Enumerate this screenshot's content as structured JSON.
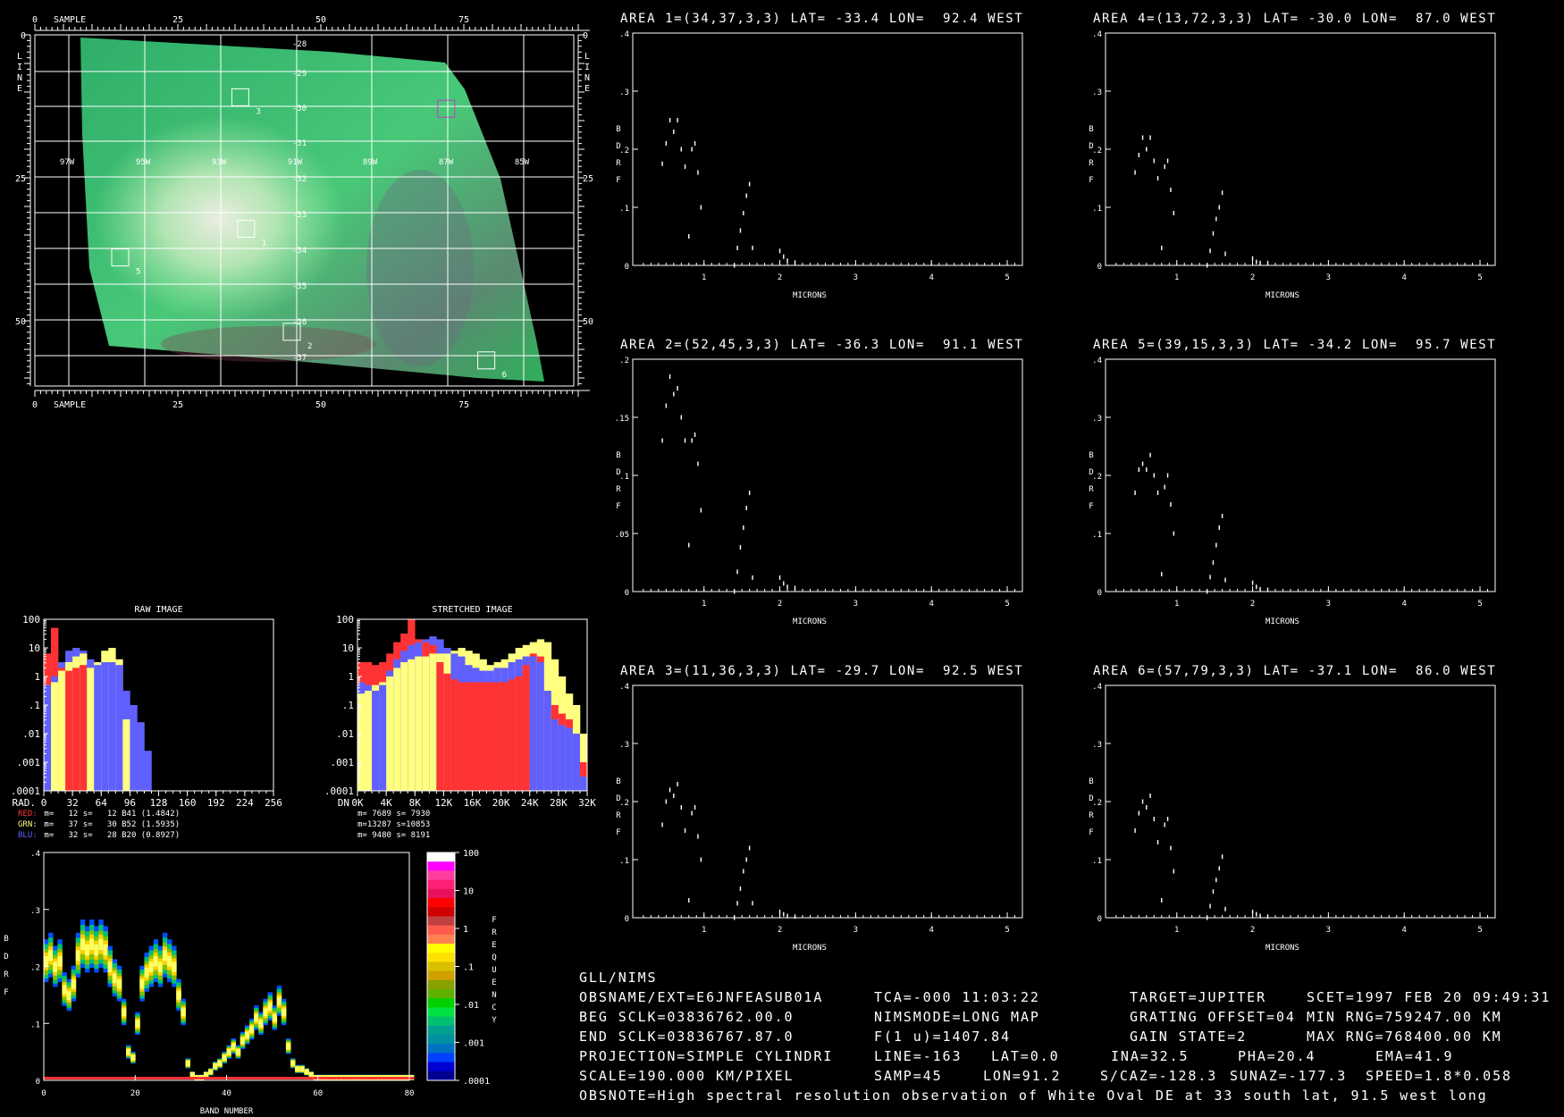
{
  "colors": {
    "red": "#ff3333",
    "green": "#ffff80",
    "blue": "#6060ff",
    "axis": "#ffffff",
    "background": "#000000",
    "map_green": "#3fbf6f"
  },
  "map": {
    "sample_label": "SAMPLE",
    "line_label": [
      "L",
      "I",
      "N",
      "E"
    ],
    "sample_ticks": [
      "0",
      "25",
      "50",
      "75"
    ],
    "line_ticks": [
      "0",
      "25",
      "50"
    ],
    "lat_labels": [
      "-28",
      "-29",
      "-30",
      "-31",
      "-32",
      "-33",
      "-34",
      "-35",
      "-36",
      "-37"
    ],
    "lon_labels": [
      "97W",
      "95W",
      "93W",
      "91W",
      "89W",
      "87W",
      "85W"
    ],
    "area_boxes": [
      {
        "label": "1",
        "line": 34,
        "sample": 37
      },
      {
        "label": "2",
        "line": 52,
        "sample": 45
      },
      {
        "label": "3",
        "line": 11,
        "sample": 36
      },
      {
        "label": "4",
        "line": 13,
        "sample": 72
      },
      {
        "label": "5",
        "line": 39,
        "sample": 15
      },
      {
        "label": "6",
        "line": 57,
        "sample": 79
      }
    ]
  },
  "spectra": [
    {
      "title": "AREA 1=(34,37,3,3) LAT= -33.4 LON=  92.4 WEST",
      "ylim": [
        0,
        0.4
      ],
      "yticks": [
        "0",
        ".1",
        ".2",
        ".3",
        ".4"
      ],
      "points": [
        [
          0.45,
          0.175
        ],
        [
          0.5,
          0.21
        ],
        [
          0.55,
          0.25
        ],
        [
          0.6,
          0.23
        ],
        [
          0.65,
          0.25
        ],
        [
          0.7,
          0.2
        ],
        [
          0.75,
          0.17
        ],
        [
          0.8,
          0.05
        ],
        [
          0.84,
          0.2
        ],
        [
          0.88,
          0.21
        ],
        [
          0.92,
          0.16
        ],
        [
          0.96,
          0.1
        ],
        [
          1.4,
          0
        ],
        [
          1.44,
          0.03
        ],
        [
          1.48,
          0.06
        ],
        [
          1.52,
          0.09
        ],
        [
          1.56,
          0.12
        ],
        [
          1.6,
          0.14
        ],
        [
          1.64,
          0.03
        ],
        [
          2.0,
          0.025
        ],
        [
          2.05,
          0.015
        ],
        [
          2.1,
          0.008
        ],
        [
          2.2,
          0.005
        ]
      ]
    },
    {
      "title": "AREA 2=(52,45,3,3) LAT= -36.3 LON=  91.1 WEST",
      "ylim": [
        0,
        0.2
      ],
      "yticks": [
        "0",
        ".05",
        ".1",
        ".15",
        ".2"
      ],
      "points": [
        [
          0.45,
          0.13
        ],
        [
          0.5,
          0.16
        ],
        [
          0.55,
          0.185
        ],
        [
          0.6,
          0.17
        ],
        [
          0.65,
          0.175
        ],
        [
          0.7,
          0.15
        ],
        [
          0.75,
          0.13
        ],
        [
          0.8,
          0.04
        ],
        [
          0.84,
          0.13
        ],
        [
          0.88,
          0.135
        ],
        [
          0.92,
          0.11
        ],
        [
          0.96,
          0.07
        ],
        [
          1.4,
          0
        ],
        [
          1.44,
          0.017
        ],
        [
          1.48,
          0.038
        ],
        [
          1.52,
          0.055
        ],
        [
          1.56,
          0.072
        ],
        [
          1.6,
          0.085
        ],
        [
          1.64,
          0.012
        ],
        [
          2.0,
          0.012
        ],
        [
          2.05,
          0.007
        ],
        [
          2.1,
          0.004
        ],
        [
          2.2,
          0.003
        ]
      ]
    },
    {
      "title": "AREA 3=(11,36,3,3) LAT= -29.7 LON=  92.5 WEST",
      "ylim": [
        0,
        0.4
      ],
      "yticks": [
        "0",
        ".1",
        ".2",
        ".3",
        ".4"
      ],
      "points": [
        [
          0.45,
          0.16
        ],
        [
          0.5,
          0.2
        ],
        [
          0.55,
          0.22
        ],
        [
          0.6,
          0.21
        ],
        [
          0.65,
          0.23
        ],
        [
          0.7,
          0.19
        ],
        [
          0.75,
          0.15
        ],
        [
          0.8,
          0.03
        ],
        [
          0.84,
          0.18
        ],
        [
          0.88,
          0.19
        ],
        [
          0.92,
          0.14
        ],
        [
          0.96,
          0.1
        ],
        [
          1.4,
          0
        ],
        [
          1.44,
          0.025
        ],
        [
          1.48,
          0.05
        ],
        [
          1.52,
          0.08
        ],
        [
          1.56,
          0.1
        ],
        [
          1.6,
          0.12
        ],
        [
          1.64,
          0.025
        ],
        [
          2.0,
          0.01
        ],
        [
          2.05,
          0.006
        ],
        [
          2.1,
          0.003
        ],
        [
          2.2,
          0.002
        ]
      ]
    },
    {
      "title": "AREA 4=(13,72,3,3) LAT= -30.0 LON=  87.0 WEST",
      "ylim": [
        0,
        0.4
      ],
      "yticks": [
        "0",
        ".1",
        ".2",
        ".3",
        ".4"
      ],
      "points": [
        [
          0.45,
          0.16
        ],
        [
          0.5,
          0.19
        ],
        [
          0.55,
          0.22
        ],
        [
          0.6,
          0.2
        ],
        [
          0.65,
          0.22
        ],
        [
          0.7,
          0.18
        ],
        [
          0.75,
          0.15
        ],
        [
          0.8,
          0.03
        ],
        [
          0.84,
          0.17
        ],
        [
          0.88,
          0.18
        ],
        [
          0.92,
          0.13
        ],
        [
          0.96,
          0.09
        ],
        [
          1.4,
          0
        ],
        [
          1.44,
          0.025
        ],
        [
          1.48,
          0.055
        ],
        [
          1.52,
          0.08
        ],
        [
          1.56,
          0.1
        ],
        [
          1.6,
          0.125
        ],
        [
          1.64,
          0.02
        ],
        [
          2.0,
          0.012
        ],
        [
          2.05,
          0.006
        ],
        [
          2.1,
          0.004
        ],
        [
          2.2,
          0.004
        ]
      ]
    },
    {
      "title": "AREA 5=(39,15,3,3) LAT= -34.2 LON=  95.7 WEST",
      "ylim": [
        0,
        0.4
      ],
      "yticks": [
        "0",
        ".1",
        ".2",
        ".3",
        ".4"
      ],
      "points": [
        [
          0.45,
          0.17
        ],
        [
          0.5,
          0.21
        ],
        [
          0.55,
          0.22
        ],
        [
          0.6,
          0.21
        ],
        [
          0.65,
          0.235
        ],
        [
          0.7,
          0.2
        ],
        [
          0.75,
          0.17
        ],
        [
          0.8,
          0.03
        ],
        [
          0.84,
          0.18
        ],
        [
          0.88,
          0.2
        ],
        [
          0.92,
          0.15
        ],
        [
          0.96,
          0.1
        ],
        [
          1.4,
          0
        ],
        [
          1.44,
          0.025
        ],
        [
          1.48,
          0.05
        ],
        [
          1.52,
          0.08
        ],
        [
          1.56,
          0.11
        ],
        [
          1.6,
          0.13
        ],
        [
          1.64,
          0.02
        ],
        [
          2.0,
          0.015
        ],
        [
          2.05,
          0.008
        ],
        [
          2.1,
          0.004
        ],
        [
          2.2,
          0.003
        ]
      ]
    },
    {
      "title": "AREA 6=(57,79,3,3) LAT= -37.1 LON=  86.0 WEST",
      "ylim": [
        0,
        0.4
      ],
      "yticks": [
        "0",
        ".1",
        ".2",
        ".3",
        ".4"
      ],
      "points": [
        [
          0.45,
          0.15
        ],
        [
          0.5,
          0.18
        ],
        [
          0.55,
          0.2
        ],
        [
          0.6,
          0.19
        ],
        [
          0.65,
          0.21
        ],
        [
          0.7,
          0.17
        ],
        [
          0.75,
          0.13
        ],
        [
          0.8,
          0.03
        ],
        [
          0.84,
          0.16
        ],
        [
          0.88,
          0.17
        ],
        [
          0.92,
          0.12
        ],
        [
          0.96,
          0.08
        ],
        [
          1.4,
          0
        ],
        [
          1.44,
          0.02
        ],
        [
          1.48,
          0.045
        ],
        [
          1.52,
          0.065
        ],
        [
          1.56,
          0.085
        ],
        [
          1.6,
          0.105
        ],
        [
          1.64,
          0.015
        ],
        [
          2.0,
          0.01
        ],
        [
          2.05,
          0.006
        ],
        [
          2.1,
          0.003
        ],
        [
          2.2,
          0.002
        ]
      ]
    }
  ],
  "spectra_common": {
    "xlabel": "MICRONS",
    "ylabel": [
      "B",
      "D",
      "R",
      "F"
    ],
    "xticks": [
      "1",
      "2",
      "3",
      "4",
      "5"
    ],
    "xlim": [
      0.06,
      5.2
    ]
  },
  "histograms": {
    "raw": {
      "title": "RAW IMAGE",
      "axis_label": "RAD.",
      "xticks": [
        "0",
        "32",
        "64",
        "96",
        "128",
        "160",
        "192",
        "224",
        "256"
      ],
      "yticks": [
        "100",
        "10",
        "1",
        ".1",
        ".01",
        ".001",
        ".0001"
      ],
      "red_log": [
        0.8,
        1.7,
        0.3,
        0.2,
        0.3,
        0.4,
        -4,
        -4,
        -4,
        -4,
        -4,
        -4,
        -4,
        -4,
        -4,
        -4,
        -4,
        -4,
        -4,
        -4,
        -4,
        -4,
        -4,
        -4,
        -4,
        -4,
        -4,
        -4,
        -4,
        -4,
        -4,
        -4
      ],
      "green_log": [
        -0.3,
        -0.2,
        0.2,
        0.5,
        0.7,
        0.8,
        0.3,
        0.5,
        0.9,
        1.0,
        0.6,
        -1.5,
        -4,
        -4,
        -4,
        -4,
        -4,
        -4,
        -4,
        -4,
        -4,
        -4,
        -4,
        -4,
        -4,
        -4,
        -4,
        -4,
        -4,
        -4,
        -4,
        -4
      ],
      "blue_log": [
        -0.3,
        0.0,
        0.5,
        0.9,
        1.0,
        0.9,
        0.6,
        0.4,
        0.5,
        0.5,
        0.4,
        -0.5,
        -1.0,
        -1.6,
        -2.6,
        -4,
        -4,
        -4,
        -4,
        -4,
        -4,
        -4,
        -4,
        -4,
        -4,
        -4,
        -4,
        -4,
        -4,
        -4,
        -4,
        -4
      ],
      "stats": [
        {
          "label": "RED:",
          "text": " m=   12 s=   12 B41 (1.4842)"
        },
        {
          "label": "GRN:",
          "text": " m=   37 s=   30 B52 (1.5935)"
        },
        {
          "label": "BLU:",
          "text": " m=   32 s=   28 B20 (0.8927)"
        }
      ]
    },
    "stretched": {
      "title": "STRETCHED IMAGE",
      "axis_label": "DN",
      "xticks": [
        "0K",
        "4K",
        "8K",
        "12K",
        "16K",
        "20K",
        "24K",
        "28K",
        "32K"
      ],
      "yticks": [
        "100",
        "10",
        "1",
        ".1",
        ".01",
        ".001",
        ".0001"
      ],
      "red_log": [
        0.5,
        0.5,
        0.4,
        0.5,
        0.8,
        1.2,
        1.5,
        2.0,
        1.3,
        1.2,
        1.1,
        0.5,
        0.1,
        -0.1,
        -0.2,
        -0.2,
        -0.2,
        -0.2,
        -0.2,
        -0.2,
        -0.2,
        -0.1,
        0.0,
        0.4,
        0.8,
        0.7,
        -0.5,
        -1.0,
        -1.3,
        -1.5,
        -2.0,
        -3.0
      ],
      "green_log": [
        -0.6,
        -0.5,
        -0.3,
        -0.2,
        0.0,
        0.3,
        0.5,
        0.6,
        0.7,
        0.7,
        0.8,
        0.8,
        0.8,
        0.9,
        1.0,
        0.9,
        0.8,
        0.6,
        0.4,
        0.5,
        0.6,
        0.8,
        1.0,
        1.1,
        1.2,
        1.3,
        1.2,
        0.6,
        0.0,
        -0.6,
        -1.0,
        -2.0
      ],
      "blue_log": [
        -0.2,
        -0.3,
        -0.5,
        -0.3,
        0.2,
        0.6,
        0.9,
        1.1,
        1.2,
        1.3,
        1.4,
        1.3,
        1.0,
        0.8,
        0.7,
        0.4,
        0.3,
        0.2,
        0.2,
        0.3,
        0.3,
        0.5,
        0.6,
        0.7,
        0.7,
        0.5,
        -0.5,
        -1.5,
        -1.7,
        -1.8,
        -2.0,
        -3.5
      ],
      "stats": [
        "m= 7689 s= 7930",
        "m=13287 s=10853",
        "m= 9480 s= 8191"
      ]
    }
  },
  "chart_data": {
    "type": "heatmap",
    "xlabel": "BAND NUMBER",
    "ylabel": "BDRF",
    "xlim": [
      0,
      80
    ],
    "ylim": [
      0,
      0.4
    ],
    "xticks": [
      "0",
      "20",
      "40",
      "60",
      "80"
    ],
    "yticks": [
      "0",
      ".1",
      ".2",
      ".3",
      ".4"
    ],
    "mean_bdrf_by_band": [
      0.21,
      0.22,
      0.2,
      0.21,
      0.16,
      0.15,
      0.17,
      0.22,
      0.24,
      0.23,
      0.24,
      0.23,
      0.24,
      0.23,
      0.2,
      0.18,
      0.17,
      0.12,
      0.05,
      0.04,
      0.1,
      0.17,
      0.19,
      0.2,
      0.21,
      0.2,
      0.22,
      0.21,
      0.2,
      0.15,
      0.12,
      0.03,
      0.01,
      0.005,
      0.005,
      0.01,
      0.015,
      0.025,
      0.03,
      0.04,
      0.05,
      0.06,
      0.05,
      0.07,
      0.08,
      0.09,
      0.11,
      0.1,
      0.12,
      0.13,
      0.11,
      0.14,
      0.12,
      0.06,
      0.03,
      0.02,
      0.02,
      0.015,
      0.01,
      0.005,
      0.005,
      0.005,
      0.005,
      0.005,
      0.005,
      0.005,
      0.005,
      0.005,
      0.005,
      0.005,
      0.005,
      0.005,
      0.005,
      0.005,
      0.005,
      0.005,
      0.005,
      0.005,
      0.005,
      0.005,
      0.005
    ],
    "colorbar": {
      "label": [
        "F",
        "R",
        "E",
        "Q",
        "U",
        "E",
        "N",
        "C",
        "Y"
      ],
      "ticks": [
        "100",
        "10",
        "1",
        ".1",
        ".01",
        ".001",
        ".0001"
      ],
      "colors": [
        "#ffffff",
        "#ff00ff",
        "#ff3fa0",
        "#ff1e78",
        "#e8105a",
        "#ff0000",
        "#d00000",
        "#c04040",
        "#ff5a50",
        "#ff8050",
        "#ffff00",
        "#ffe000",
        "#d8c000",
        "#d0a000",
        "#88a000",
        "#60b000",
        "#00d000",
        "#00e040",
        "#00c070",
        "#00a090",
        "#0090a0",
        "#0070c0",
        "#0040ff",
        "#0000d0",
        "#000090"
      ]
    }
  },
  "info": {
    "header": "GLL/NIMS",
    "rows": [
      [
        "OBSNAME/EXT=E6JNFEASUB01A",
        "TCA=-000 11:03:22",
        "TARGET=JUPITER",
        "SCET=1997 FEB 20 09:49:31"
      ],
      [
        "BEG SCLK=03836762.00.0",
        "NIMSMODE=LONG MAP",
        "GRATING OFFSET=04",
        "MIN RNG=759247.00 KM"
      ],
      [
        "END SCLK=03836767.87.0",
        "F(1 u)=1407.84",
        "GAIN STATE=2",
        "MAX RNG=768400.00 KM"
      ]
    ],
    "row5": [
      "PROJECTION=SIMPLE CYLINDRI",
      "LINE=-163",
      "LAT=0.0",
      "INA=32.5",
      "PHA=20.4",
      "EMA=41.9"
    ],
    "row6": [
      "SCALE=190.000 KM/PIXEL",
      "SAMP=45",
      "LON=91.2",
      "S/CAZ=-128.3",
      "SUNAZ=-177.3",
      "SPEED=1.8*0.058"
    ],
    "obsnote": "OBSNOTE=High spectral resolution observation of White Oval DE at 33 south lat, 91.5 west long"
  }
}
